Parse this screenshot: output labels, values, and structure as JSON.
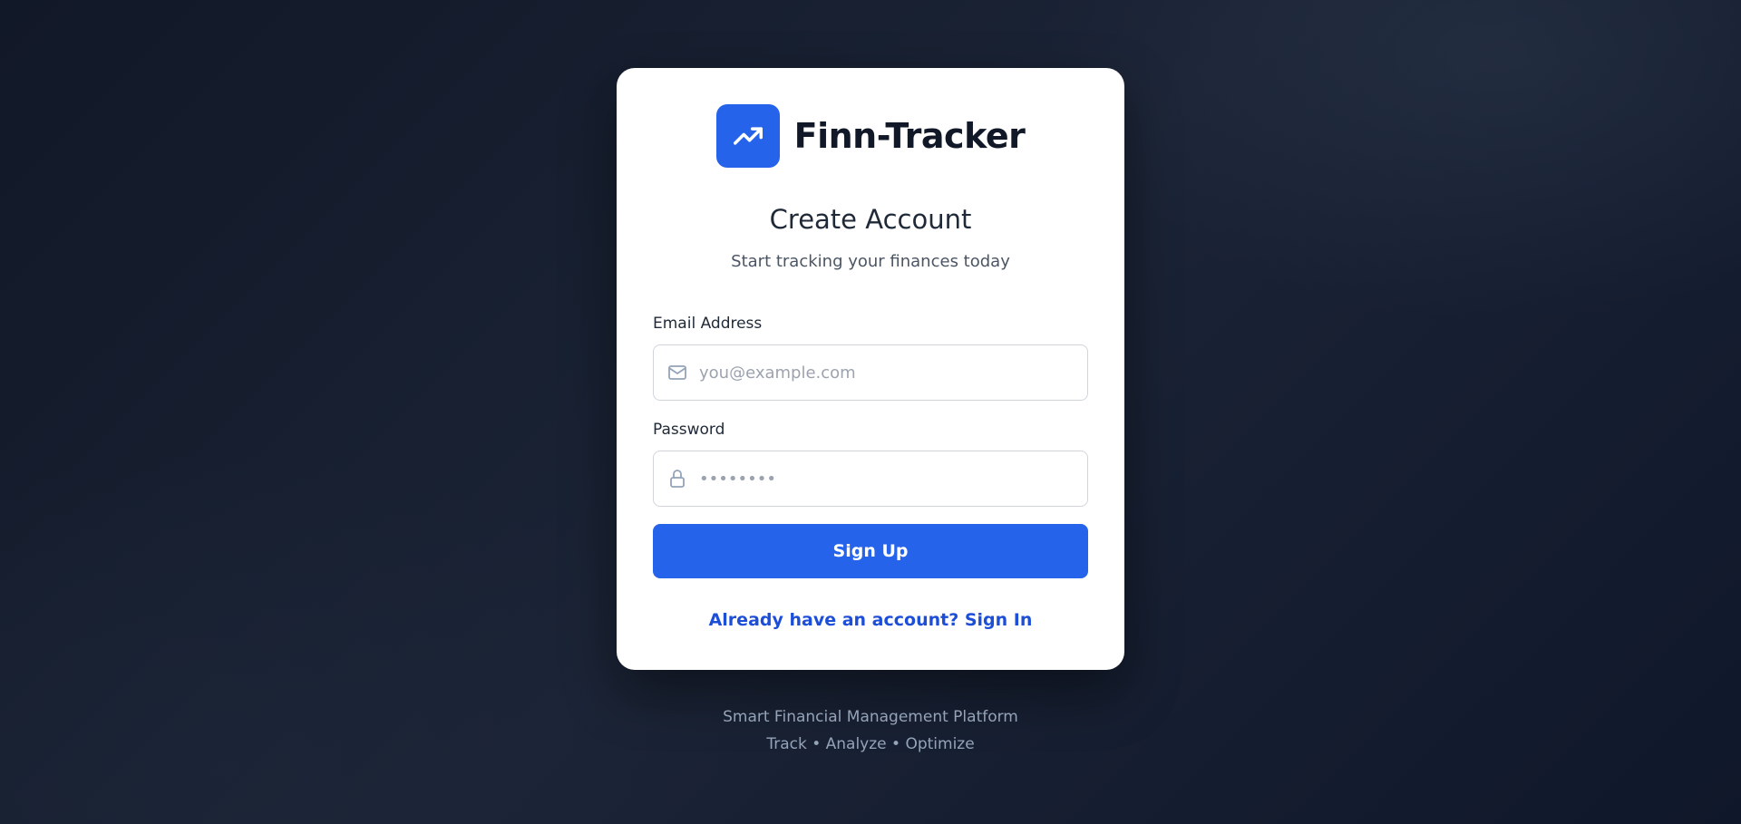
{
  "brand": {
    "name": "Finn-Tracker",
    "logo_icon": "trending-up-icon",
    "accent_color": "#2563eb"
  },
  "form": {
    "title": "Create Account",
    "subtitle": "Start tracking your finances today",
    "email": {
      "label": "Email Address",
      "placeholder": "you@example.com",
      "value": "",
      "icon": "mail-icon"
    },
    "password": {
      "label": "Password",
      "placeholder": "••••••••",
      "value": "",
      "icon": "lock-icon"
    },
    "submit_label": "Sign Up",
    "signin_link": "Already have an account? Sign In"
  },
  "footer": {
    "tagline": "Smart Financial Management Platform",
    "motto": "Track • Analyze • Optimize"
  }
}
